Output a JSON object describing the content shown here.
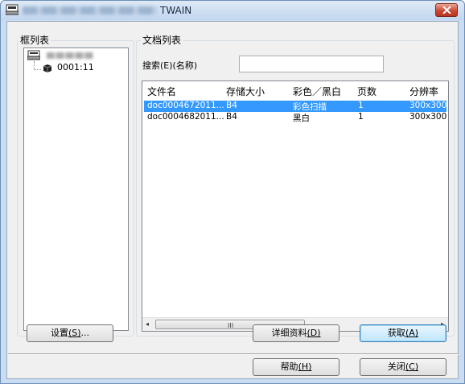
{
  "window": {
    "title_visible": "TWAIN",
    "title_prefix_blurred": true
  },
  "tree_panel": {
    "label": "框列表",
    "root_label_blurred": true,
    "child": {
      "label": "0001:11"
    }
  },
  "doc_panel": {
    "label": "文档列表",
    "search_label": "搜索(E)(名称)",
    "search_value": "",
    "columns": [
      "文件名",
      "存储大小",
      "彩色／黑白",
      "页数",
      "分辨率"
    ],
    "rows": [
      {
        "name": "doc0004672011...",
        "size": "B4",
        "color": "彩色扫描",
        "pages": "1",
        "resolution": "300x300",
        "selected": true
      },
      {
        "name": "doc0004682011...",
        "size": "B4",
        "color": "黑白",
        "pages": "1",
        "resolution": "300x300",
        "selected": false
      }
    ],
    "scroll_grip": "III",
    "scroll_left": "◂",
    "scroll_right": "▸"
  },
  "buttons": {
    "settings": {
      "text": "设置",
      "hotkey": "(S)",
      "suffix": "..."
    },
    "details": {
      "text": "详细资料",
      "hotkey": "(D)"
    },
    "acquire": {
      "text": "获取",
      "hotkey": "(A)"
    },
    "help": {
      "text": "帮助",
      "hotkey": "(H)"
    },
    "close": {
      "text": "关闭",
      "hotkey": "(C)"
    }
  },
  "colors": {
    "selection": "#3399ff",
    "title_bar": "#c2d6ef",
    "close_button": "#c8452f"
  }
}
